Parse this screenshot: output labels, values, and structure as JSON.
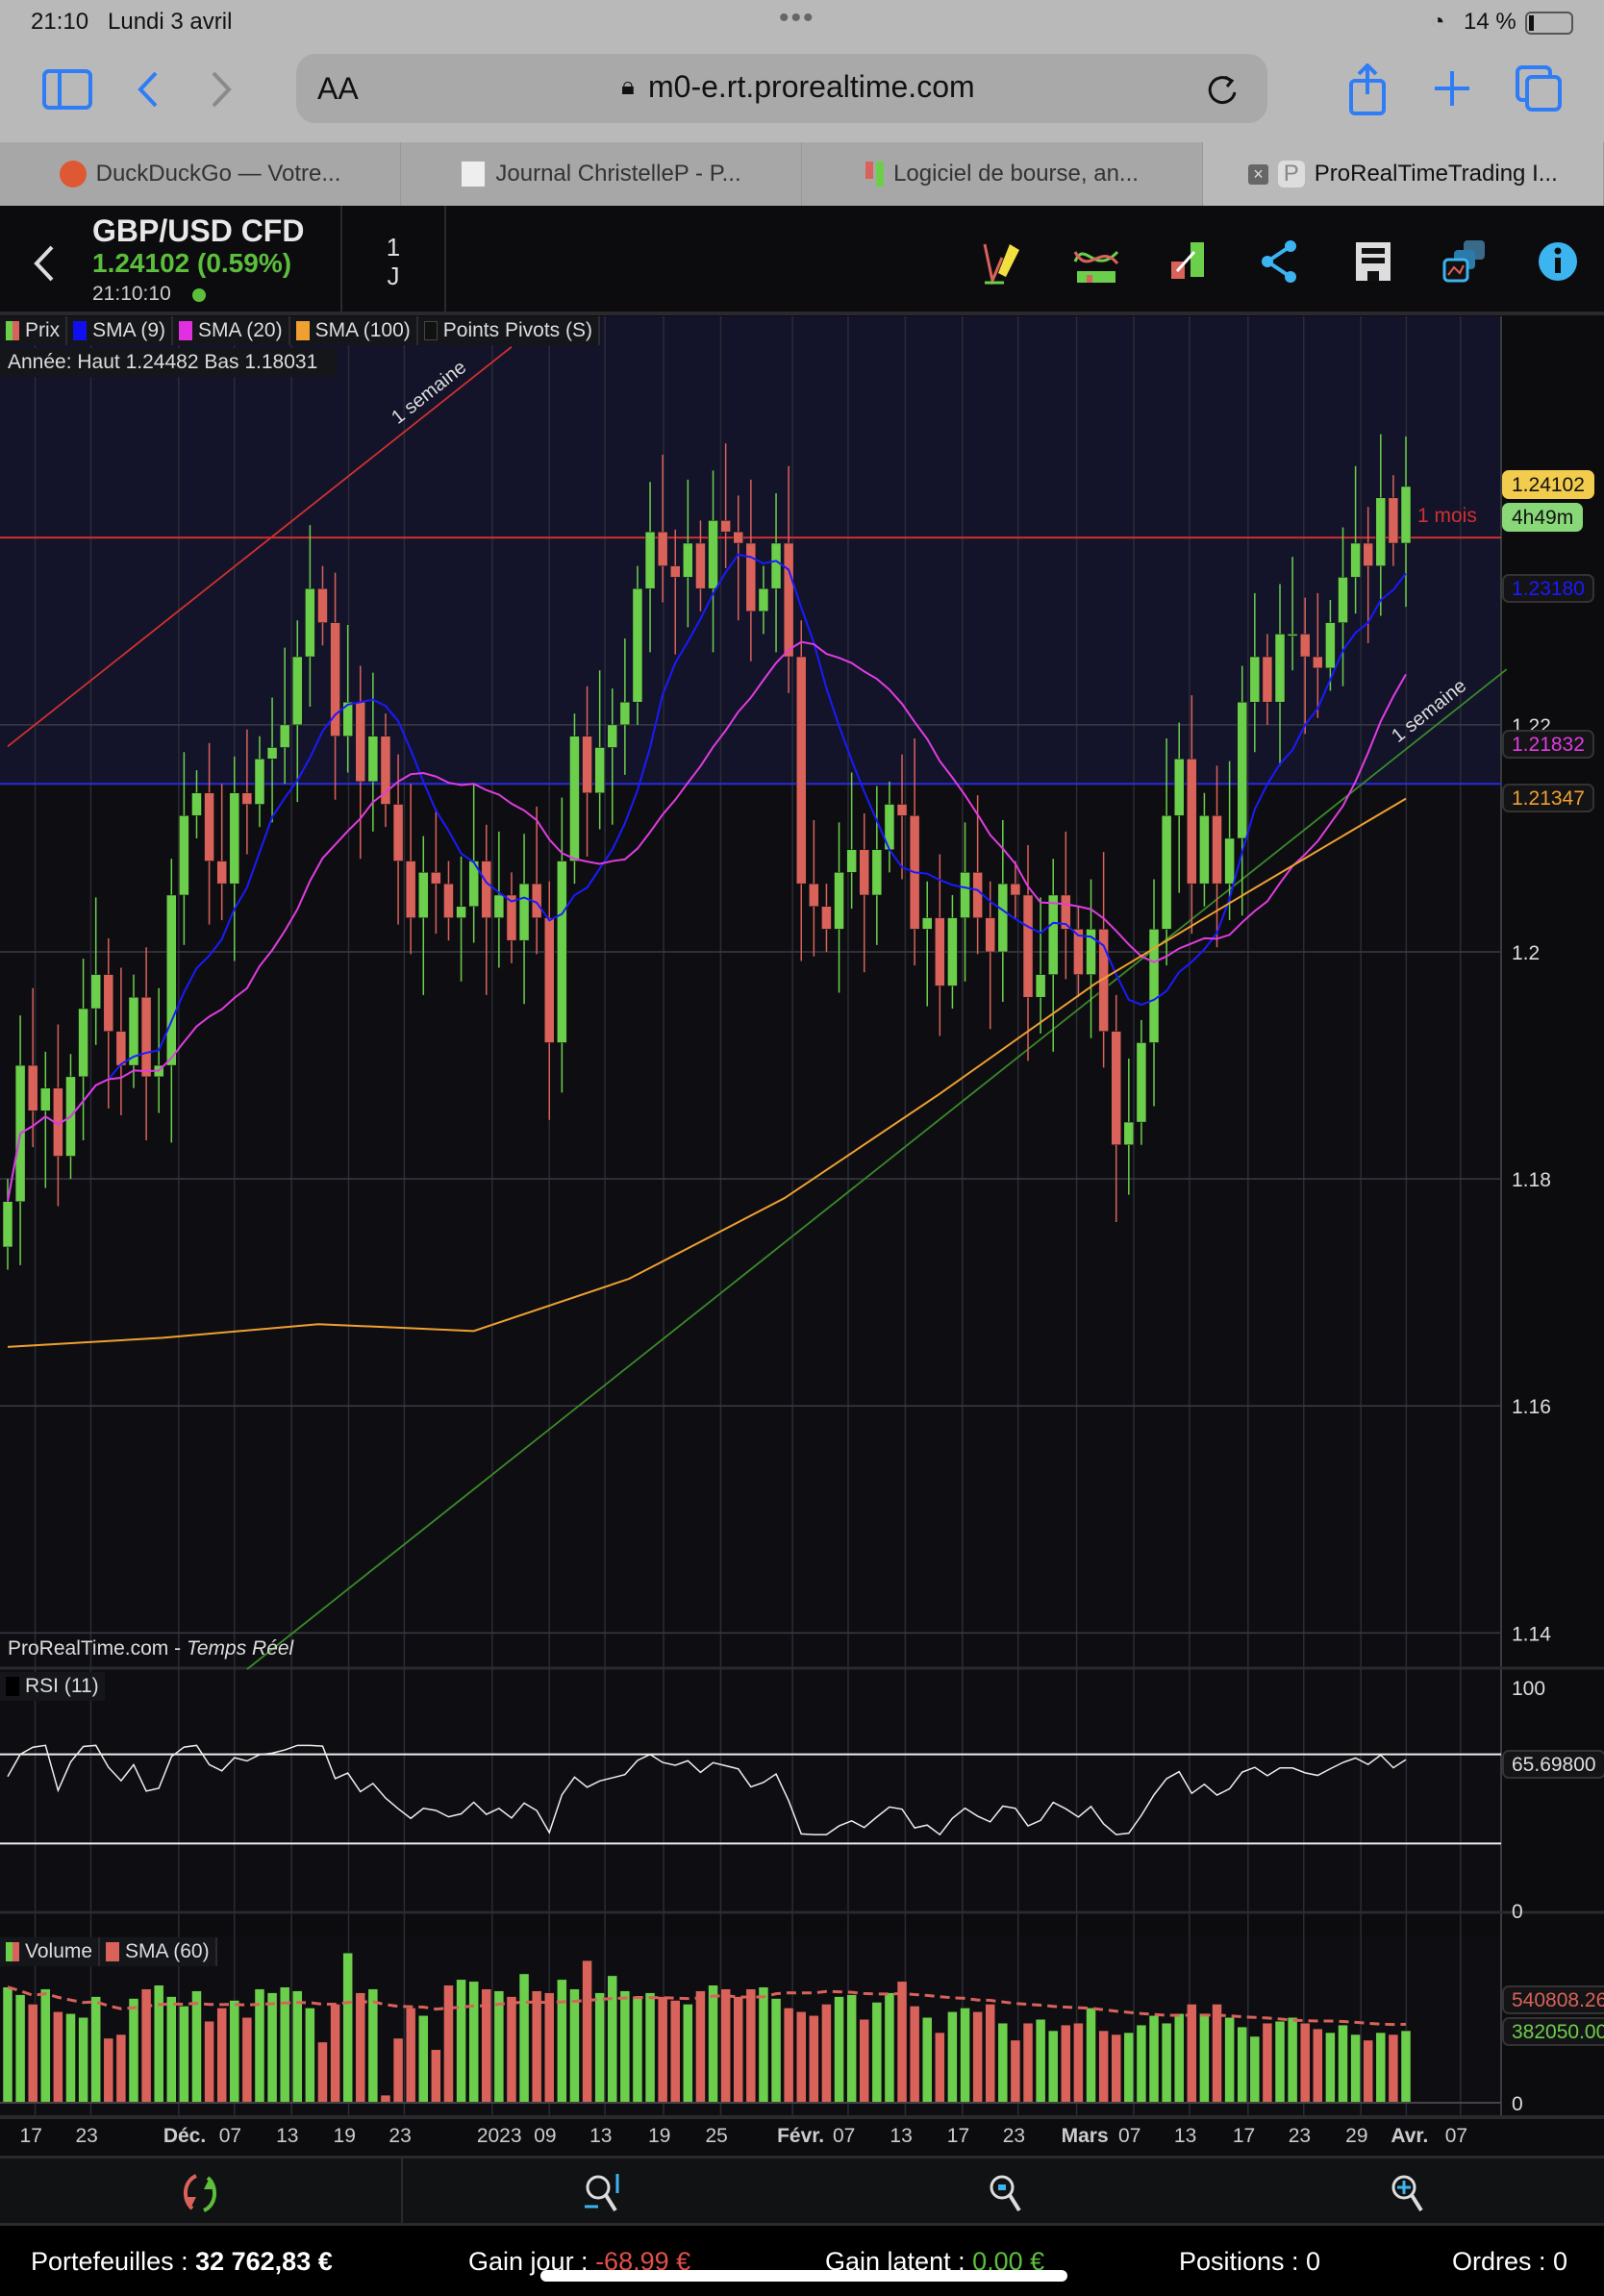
{
  "status": {
    "time": "21:10",
    "date": "Lundi 3 avril",
    "battery": "14 %"
  },
  "browser": {
    "text_size": "AA",
    "url": "m0-e.rt.prorealtime.com",
    "tabs": [
      {
        "label": "DuckDuckGo — Votre..."
      },
      {
        "label": "Journal ChristelleP - P..."
      },
      {
        "label": "Logiciel de bourse, an..."
      },
      {
        "label": "ProRealTimeTrading I...",
        "active": true
      }
    ]
  },
  "header": {
    "instrument": "GBP/USD CFD",
    "price_change": "1.24102 (0.59%)",
    "clock": "21:10:10",
    "period_num": "1",
    "period_unit": "J",
    "icons": [
      "drawing-pencil-icon",
      "indicators-icon",
      "trade-icon",
      "share-icon",
      "save-icon",
      "layouts-icon",
      "info-icon"
    ]
  },
  "legend": {
    "items": [
      {
        "label": "Prix",
        "color": "#6ccf4c"
      },
      {
        "label": "SMA (9)",
        "color": "#1010ee"
      },
      {
        "label": "SMA (20)",
        "color": "#e030e0"
      },
      {
        "label": "SMA (100)",
        "color": "#f0a030"
      },
      {
        "label": "Points Pivots (S)",
        "color": "#111111"
      }
    ],
    "year_info": "Année: Haut 1.24482 Bas 1.18031"
  },
  "watermark": {
    "brand": "ProRealTime.com",
    "mode": "Temps Réel"
  },
  "price_labels": {
    "last": "1.24102",
    "countdown": "4h49m",
    "sma9": "1.23180",
    "sma20": "1.21832",
    "sma100": "1.21347"
  },
  "colors": {
    "up": "#6ccf4c",
    "down": "#d9625a",
    "sma9": "#1a1aff",
    "sma20": "#e03ce0",
    "sma100": "#f0a030",
    "chart_bg": "#0e0e12",
    "zone_bg": "#13142a"
  },
  "chart_data": {
    "type": "candlestick",
    "price_ticks": [
      "1.14",
      "1.16",
      "1.18",
      "1.2",
      "1.22"
    ],
    "ylim": [
      1.1345,
      1.2545
    ],
    "closes": [
      1.178,
      1.19,
      1.186,
      1.188,
      1.182,
      1.189,
      1.195,
      1.198,
      1.193,
      1.19,
      1.196,
      1.189,
      1.19,
      1.205,
      1.212,
      1.214,
      1.208,
      1.206,
      1.214,
      1.213,
      1.217,
      1.218,
      1.22,
      1.226,
      1.232,
      1.229,
      1.219,
      1.222,
      1.215,
      1.219,
      1.213,
      1.208,
      1.203,
      1.207,
      1.206,
      1.203,
      1.204,
      1.208,
      1.203,
      1.205,
      1.201,
      1.206,
      1.203,
      1.192,
      1.208,
      1.219,
      1.214,
      1.218,
      1.22,
      1.222,
      1.232,
      1.237,
      1.234,
      1.233,
      1.236,
      1.232,
      1.238,
      1.237,
      1.236,
      1.23,
      1.232,
      1.236,
      1.226,
      1.206,
      1.204,
      1.202,
      1.207,
      1.209,
      1.205,
      1.209,
      1.213,
      1.212,
      1.202,
      1.203,
      1.197,
      1.203,
      1.207,
      1.203,
      1.2,
      1.206,
      1.205,
      1.196,
      1.198,
      1.205,
      1.202,
      1.198,
      1.202,
      1.193,
      1.183,
      1.185,
      1.192,
      1.202,
      1.212,
      1.217,
      1.206,
      1.212,
      1.206,
      1.21,
      1.222,
      1.226,
      1.222,
      1.228,
      1.228,
      1.226,
      1.225,
      1.229,
      1.233,
      1.236,
      1.234,
      1.24,
      1.236,
      1.241
    ],
    "sma100": [
      1.1652,
      1.166,
      1.1672,
      1.1666,
      1.1712,
      1.1783,
      1.1875,
      1.1972,
      1.2054,
      1.2135
    ],
    "horizontal_lines": [
      {
        "label": "1 mois",
        "price": 1.2365,
        "color": "#d03030"
      },
      {
        "label": "",
        "price": 1.2148,
        "color": "#2a2ae0"
      }
    ],
    "trendlines": [
      {
        "label": "1 semaine",
        "from": [
          0,
          1.2181
        ],
        "to": [
          40,
          1.2533
        ],
        "color": "#d03030"
      },
      {
        "label": "1 semaine",
        "from": [
          19,
          1.1368
        ],
        "to": [
          119,
          1.2249
        ],
        "color": "#3a8a2a"
      }
    ],
    "rsi": {
      "label": "RSI (11)",
      "value": "65.69800",
      "ticks": [
        "100",
        "0"
      ],
      "levels": [
        70,
        30
      ]
    },
    "volume": {
      "label": "Volume",
      "sma_label": "SMA (60)",
      "sma_value": "540808.26",
      "last_value": "382050.00",
      "zero": "0",
      "values": [
        610000,
        570000,
        520000,
        600000,
        480000,
        470000,
        450000,
        560000,
        340000,
        360000,
        550000,
        600000,
        620000,
        560000,
        510000,
        590000,
        430000,
        500000,
        540000,
        450000,
        600000,
        580000,
        610000,
        590000,
        500000,
        320000,
        520000,
        790000,
        580000,
        600000,
        40000,
        340000,
        500000,
        460000,
        280000,
        620000,
        650000,
        640000,
        600000,
        590000,
        560000,
        680000,
        590000,
        580000,
        650000,
        600000,
        750000,
        580000,
        670000,
        590000,
        560000,
        580000,
        560000,
        540000,
        520000,
        590000,
        620000,
        600000,
        560000,
        600000,
        610000,
        550000,
        500000,
        480000,
        460000,
        520000,
        560000,
        570000,
        440000,
        530000,
        580000,
        640000,
        510000,
        450000,
        370000,
        480000,
        500000,
        480000,
        520000,
        420000,
        330000,
        420000,
        440000,
        380000,
        410000,
        420000,
        500000,
        380000,
        360000,
        370000,
        410000,
        460000,
        420000,
        470000,
        520000,
        470000,
        520000,
        450000,
        400000,
        350000,
        420000,
        430000,
        450000,
        420000,
        390000,
        370000,
        410000,
        360000,
        330000,
        370000,
        360000,
        380000
      ]
    },
    "x_labels": [
      "17",
      "23",
      "Déc.",
      "07",
      "13",
      "19",
      "23",
      "2023",
      "09",
      "13",
      "19",
      "25",
      "Févr.",
      "07",
      "13",
      "17",
      "23",
      "Mars",
      "07",
      "13",
      "17",
      "23",
      "29",
      "Avr.",
      "07"
    ]
  },
  "bottom_toolbar": {
    "icons": [
      "refresh-icon",
      "zoom-fit-icon",
      "zoom-out-icon",
      "zoom-in-icon"
    ]
  },
  "footer": {
    "portfolio_label": "Portefeuilles : ",
    "portfolio_value": "32 762,83 €",
    "day_gain_label": "Gain jour : ",
    "day_gain_value": "-68,99 €",
    "latent_label": "Gain latent : ",
    "latent_value": "0,00 €",
    "positions": "Positions : 0",
    "orders": "Ordres : 0"
  }
}
